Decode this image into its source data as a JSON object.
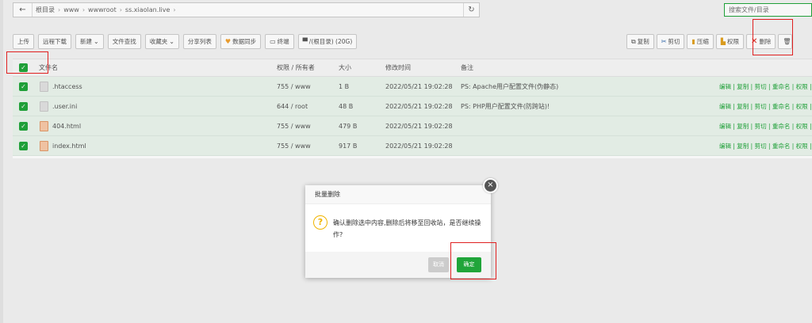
{
  "breadcrumb": {
    "back_icon": "arrow-left-icon",
    "items": [
      "根目录",
      "www",
      "wwwroot",
      "ss.xiaolan.live"
    ],
    "refresh_icon": "refresh-icon"
  },
  "search": {
    "placeholder": "搜索文件/目录"
  },
  "toolbar": {
    "upload": "上传",
    "remote_download": "远程下载",
    "new": "新建",
    "file_search": "文件查找",
    "favorites": "收藏夹",
    "share_list": "分享列表",
    "data_sync": "数据同步",
    "terminal": "终端",
    "disk": "/(根目录) (20G)"
  },
  "right_toolbar": {
    "copy": "复制",
    "cut": "剪切",
    "compress": "压缩",
    "permission": "权限",
    "delete": "删除"
  },
  "table": {
    "headers": {
      "name": "文件名",
      "permission": "权限 / 所有者",
      "size": "大小",
      "mtime": "修改时间",
      "remark": "备注"
    },
    "rows": [
      {
        "name": ".htaccess",
        "permission": "755 / www",
        "size": "1 B",
        "mtime": "2022/05/21 19:02:28",
        "remark": "PS: Apache用户配置文件(伪静态)",
        "type": "txt"
      },
      {
        "name": ".user.ini",
        "permission": "644 / root",
        "size": "48 B",
        "mtime": "2022/05/21 19:02:28",
        "remark": "PS: PHP用户配置文件(防跨站)!",
        "type": "txt"
      },
      {
        "name": "404.html",
        "permission": "755 / www",
        "size": "479 B",
        "mtime": "2022/05/21 19:02:28",
        "remark": "",
        "type": "html"
      },
      {
        "name": "index.html",
        "permission": "755 / www",
        "size": "917 B",
        "mtime": "2022/05/21 19:02:28",
        "remark": "",
        "type": "html"
      }
    ],
    "row_ops": "编辑 | 复制 | 剪切 | 重命名 | 权限 |"
  },
  "dialog": {
    "title": "批量删除",
    "message": "确认删除选中内容,删除后将移至回收站，是否继续操作?",
    "cancel": "取消",
    "confirm": "确定",
    "close_icon": "close-icon",
    "question_icon": "question-icon"
  },
  "accent_color": "#20a53a",
  "highlight_color": "#e02020"
}
